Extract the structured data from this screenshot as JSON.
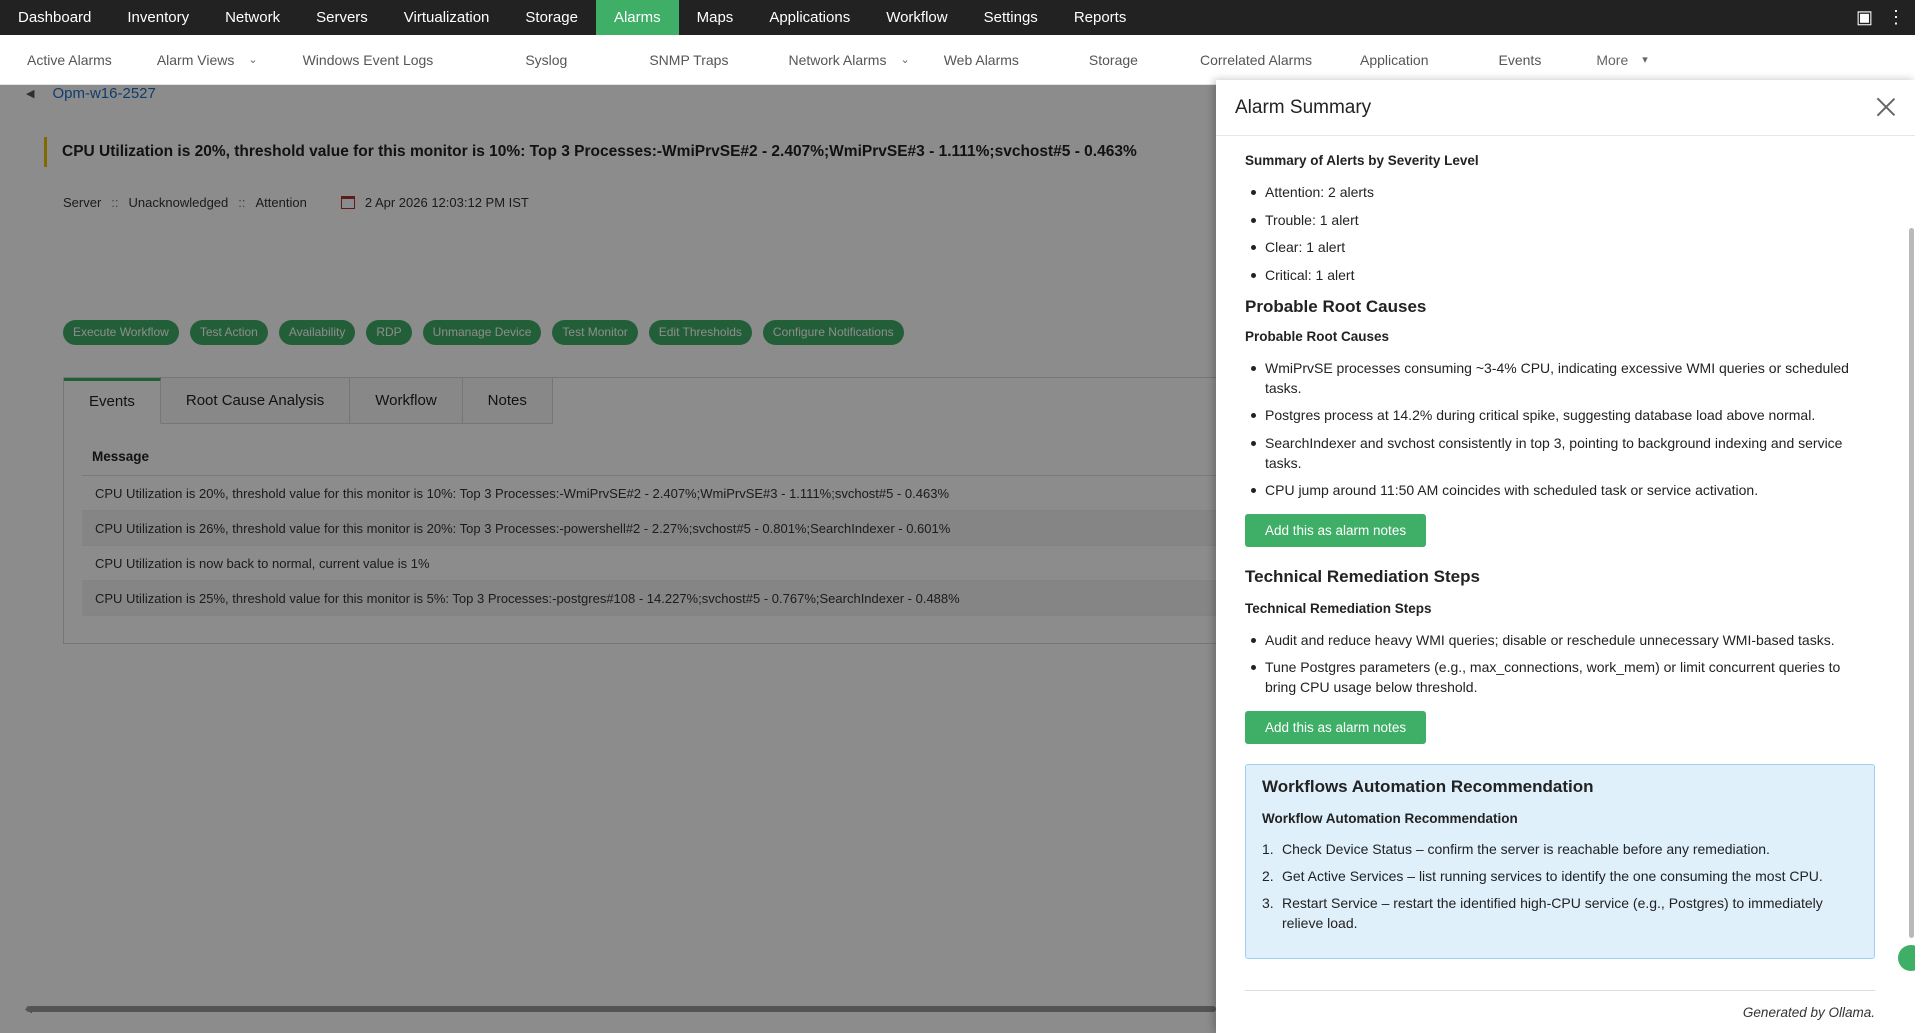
{
  "topnav": {
    "items": [
      "Dashboard",
      "Inventory",
      "Network",
      "Servers",
      "Virtualization",
      "Storage",
      "Alarms",
      "Maps",
      "Applications",
      "Workflow",
      "Settings",
      "Reports"
    ],
    "active": "Alarms"
  },
  "subnav": {
    "items": [
      "Active Alarms",
      "Alarm Views",
      "Windows Event Logs",
      "Syslog",
      "SNMP Traps",
      "Network Alarms",
      "Web Alarms",
      "Storage",
      "Correlated Alarms",
      "Application",
      "Events"
    ],
    "more": "More"
  },
  "breadcrumb": {
    "device": "Opm-w16-2527"
  },
  "alarm": {
    "title": "CPU Utilization is 20%, threshold value for this monitor is 10%: Top 3 Processes:-WmiPrvSE#2 - 2.407%;WmiPrvSE#3 - 1.111%;svchost#5 - 0.463%",
    "category": "Server",
    "status": "Unacknowledged",
    "severity": "Attention",
    "sep": "::",
    "timestamp": "2 Apr 2026 12:03:12 PM IST"
  },
  "actions": [
    "Execute Workflow",
    "Test Action",
    "Availability",
    "RDP",
    "Unmanage Device",
    "Test Monitor",
    "Edit Thresholds",
    "Configure Notifications"
  ],
  "tabs": [
    "Events",
    "Root Cause Analysis",
    "Workflow",
    "Notes"
  ],
  "events": {
    "header": "Message",
    "rows": [
      "CPU Utilization is 20%, threshold value for this monitor is 10%: Top 3 Processes:-WmiPrvSE#2 - 2.407%;WmiPrvSE#3 - 1.111%;svchost#5 - 0.463%",
      "CPU Utilization is 26%, threshold value for this monitor is 20%: Top 3 Processes:-powershell#2 - 2.27%;svchost#5 - 0.801%;SearchIndexer - 0.601%",
      "CPU Utilization is now back to normal, current value is 1%",
      "CPU Utilization is 25%, threshold value for this monitor is 5%: Top 3 Processes:-postgres#108 - 14.227%;svchost#5 - 0.767%;SearchIndexer - 0.488%"
    ]
  },
  "panel": {
    "title": "Alarm Summary",
    "summary_heading": "Summary of Alerts by Severity Level",
    "summary_items": [
      "Attention: 2 alerts",
      "Trouble: 1 alert",
      "Clear: 1 alert",
      "Critical: 1 alert"
    ],
    "root_big": "Probable Root Causes",
    "root_small": "Probable Root Causes",
    "root_items": [
      "WmiPrvSE processes consuming ~3-4% CPU, indicating excessive WMI queries or scheduled tasks.",
      "Postgres process at 14.2% during critical spike, suggesting database load above normal.",
      "SearchIndexer and svchost consistently in top 3, pointing to background indexing and service tasks.",
      "CPU jump around 11:50 AM coincides with scheduled task or service activation."
    ],
    "add_notes_label": "Add this as alarm notes",
    "rem_big": "Technical Remediation Steps",
    "rem_small": "Technical Remediation Steps",
    "rem_items": [
      "Audit and reduce heavy WMI queries; disable or reschedule unnecessary WMI-based tasks.",
      "Tune Postgres parameters (e.g., max_connections, work_mem) or limit concurrent queries to bring CPU usage below threshold."
    ],
    "wf_title": "Workflows Automation Recommendation",
    "wf_sub": "Workflow Automation Recommendation",
    "wf_items": [
      {
        "n": "1.",
        "text": "Check Device Status – confirm the server is reachable before any remediation."
      },
      {
        "n": "2.",
        "text": "Get Active Services – list running services to identify the one consuming the most CPU."
      },
      {
        "n": "3.",
        "text": "Restart Service – restart the identified high-CPU service (e.g., Postgres) to immediately relieve load."
      }
    ],
    "generated": "Generated by Ollama."
  },
  "colors": {
    "accent": "#3fae67",
    "topbar": "#222222",
    "link": "#1e70c2",
    "info_box": "#dff0fb"
  }
}
